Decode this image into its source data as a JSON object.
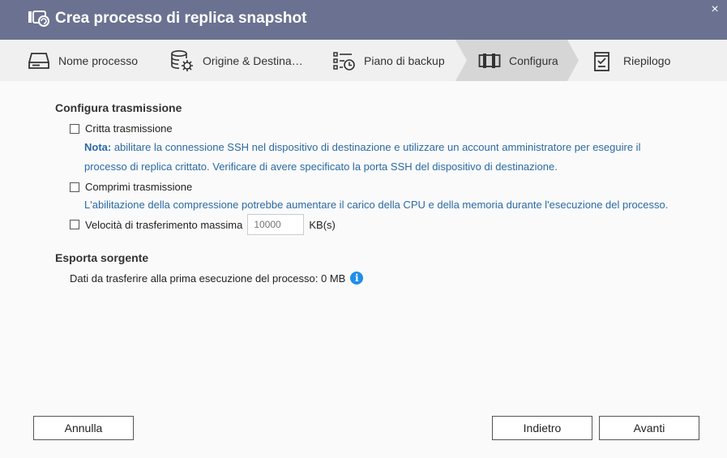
{
  "window": {
    "title": "Crea processo di replica snapshot",
    "close_glyph": "×"
  },
  "steps": [
    {
      "label": "Nome processo",
      "icon": "drive-icon"
    },
    {
      "label": "Origine & Destina…",
      "icon": "database-gear-icon"
    },
    {
      "label": "Piano di backup",
      "icon": "schedule-list-icon"
    },
    {
      "label": "Configura",
      "icon": "settings-panel-icon",
      "active": true
    },
    {
      "label": "Riepilogo",
      "icon": "clipboard-check-icon"
    }
  ],
  "transmission": {
    "title": "Configura trasmissione",
    "encrypt_label": "Critta trasmissione",
    "encrypt_checked": false,
    "encrypt_note_prefix": "Nota:",
    "encrypt_note_line1": " abilitare la connessione SSH nel dispositivo di destinazione e utilizzare un account amministratore per eseguire il",
    "encrypt_note_line2": "processo di replica crittato. Verificare di avere specificato la porta SSH del dispositivo di destinazione.",
    "compress_label": "Comprimi trasmissione",
    "compress_checked": false,
    "compress_note": "L'abilitazione della compressione potrebbe aumentare il carico della CPU e della memoria durante l'esecuzione del processo.",
    "speed_label": "Velocità di trasferimento massima",
    "speed_checked": false,
    "speed_placeholder": "10000",
    "speed_unit": "KB(s)"
  },
  "export_source": {
    "title": "Esporta sorgente",
    "data_text": "Dati da trasferire alla prima esecuzione del processo: 0 MB",
    "info_glyph": "i"
  },
  "buttons": {
    "cancel": "Annulla",
    "back": "Indietro",
    "next": "Avanti"
  },
  "colors": {
    "titlebar": "#6b7291",
    "note": "#2b6aa5",
    "info": "#1f8ee8",
    "active_step": "#d6d6d6"
  }
}
